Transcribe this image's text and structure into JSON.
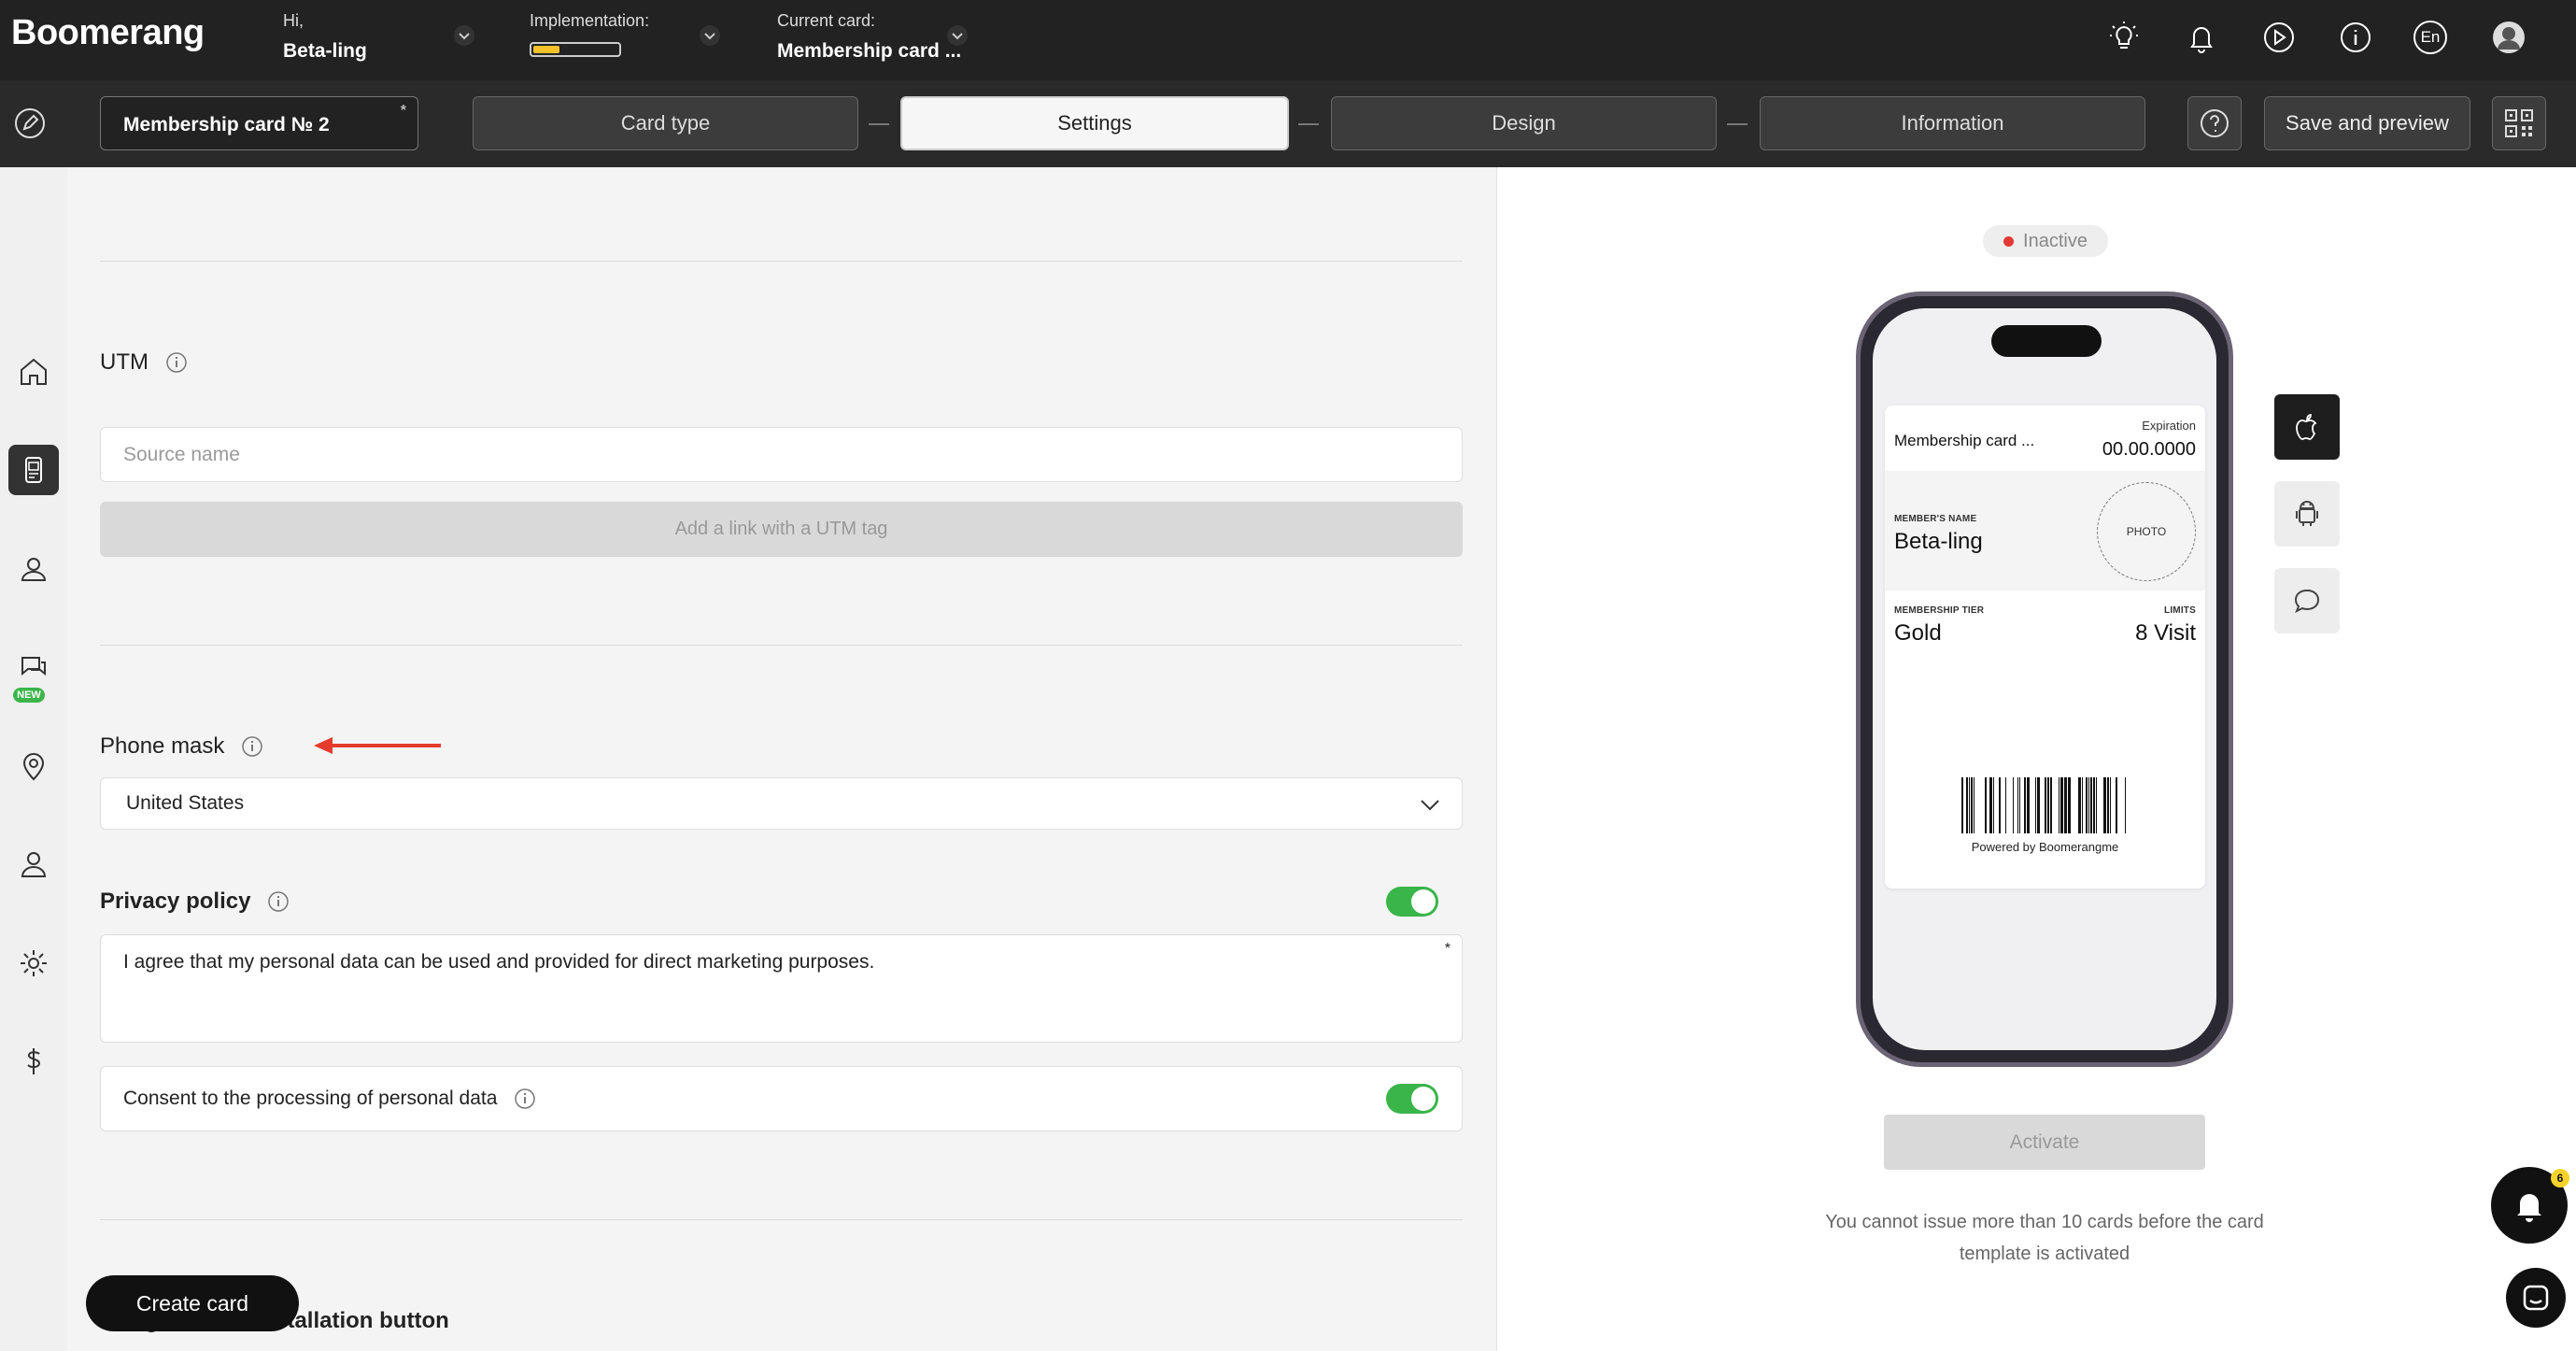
{
  "app": {
    "logo": "Boomerang"
  },
  "topbar": {
    "greeting_label": "Hi,",
    "user_name": "Beta-ling",
    "implementation_label": "Implementation:",
    "implementation_progress": 0.3,
    "current_card_label": "Current card:",
    "current_card_value": "Membership card ...",
    "language": "En",
    "icons": [
      "lightbulb-icon",
      "bell-icon",
      "play-icon",
      "info-icon",
      "language-icon",
      "avatar"
    ]
  },
  "toolbar": {
    "card_name": "Membership card № 2",
    "card_name_marker": "*",
    "steps": [
      {
        "label": "Card type",
        "active": false
      },
      {
        "label": "Settings",
        "active": true
      },
      {
        "label": "Design",
        "active": false
      },
      {
        "label": "Information",
        "active": false
      }
    ],
    "save_label": "Save and preview"
  },
  "sidebar": {
    "items": [
      "home-icon",
      "card-icon",
      "customers-icon",
      "chat-icon",
      "location-icon",
      "user-icon",
      "gear-icon",
      "dollar-icon"
    ],
    "new_badge": "NEW"
  },
  "form": {
    "utm": {
      "title": "UTM",
      "source_placeholder": "Source name",
      "add_link_label": "Add a link with a UTM tag"
    },
    "phone_mask": {
      "title": "Phone mask",
      "selected": "United States"
    },
    "privacy": {
      "title": "Privacy policy",
      "enabled": true,
      "text": "I agree that my personal data can be used and provided for direct marketing purposes.",
      "required_marker": "*"
    },
    "consent": {
      "label": "Consent to the processing of personal data",
      "enabled": true
    },
    "next_section_title": "Google Wallet Installation button",
    "create_card_label": "Create card"
  },
  "preview": {
    "status": "Inactive",
    "status_color": "#e53935",
    "pass": {
      "title": "Membership card ...",
      "expiration_label": "Expiration",
      "expiration_value": "00.00.0000",
      "member_name_label": "MEMBER'S NAME",
      "member_name_value": "Beta-ling",
      "photo_label": "PHOTO",
      "tier_label": "MEMBERSHIP TIER",
      "tier_value": "Gold",
      "limits_label": "LIMITS",
      "limits_value": "8 Visit",
      "powered_by": "Powered by Boomerangme"
    },
    "platforms": [
      "apple-icon",
      "android-icon",
      "chat-bubble-icon"
    ],
    "activate_label": "Activate",
    "note": "You cannot issue more than 10 cards before the card template is activated",
    "notification_count": "6"
  },
  "colors": {
    "accent_toggle": "#39b54a",
    "progress": "#f6c22b",
    "dark": "#222222"
  }
}
